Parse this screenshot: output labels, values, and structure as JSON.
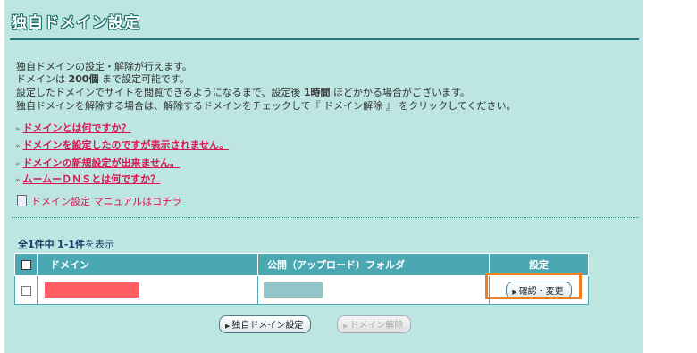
{
  "header": {
    "title": "独自ドメイン設定"
  },
  "description": {
    "line1": "独自ドメインの設定・解除が行えます。",
    "line2_pre": "ドメインは ",
    "line2_bold": "200個",
    "line2_post": " まで設定可能です。",
    "line3_pre": "設定したドメインでサイトを閲覧できるようになるまで、設定後 ",
    "line3_bold": "1時間",
    "line3_post": " ほどかかる場合がございます。",
    "line4": "独自ドメインを解除する場合は、解除するドメインをチェックして『 ドメイン解除 』 をクリックしてください。"
  },
  "faq": [
    {
      "label": "ドメインとは何ですか？"
    },
    {
      "label": "ドメインを設定したのですが表示されません。"
    },
    {
      "label": "ドメインの新規設定が出来ません。"
    },
    {
      "label": "ムームーＤＮＳとは何ですか？"
    }
  ],
  "manual_link": "ドメイン設定 マニュアルはコチラ",
  "count": {
    "total_label": "全1件中",
    "range": "1-1件",
    "suffix": "を表示"
  },
  "table": {
    "headers": {
      "domain": "ドメイン",
      "folder": "公開（アップロード）フォルダ",
      "settings": "設定"
    },
    "rows": [
      {
        "action_label": "確認・変更"
      }
    ]
  },
  "buttons": {
    "add": "独自ドメイン設定",
    "remove": "ドメイン解除"
  },
  "colors": {
    "panel_bg": "#bde6e2",
    "header_bg": "#4aa8b3",
    "link": "#d81450",
    "highlight": "#ef7f22"
  }
}
